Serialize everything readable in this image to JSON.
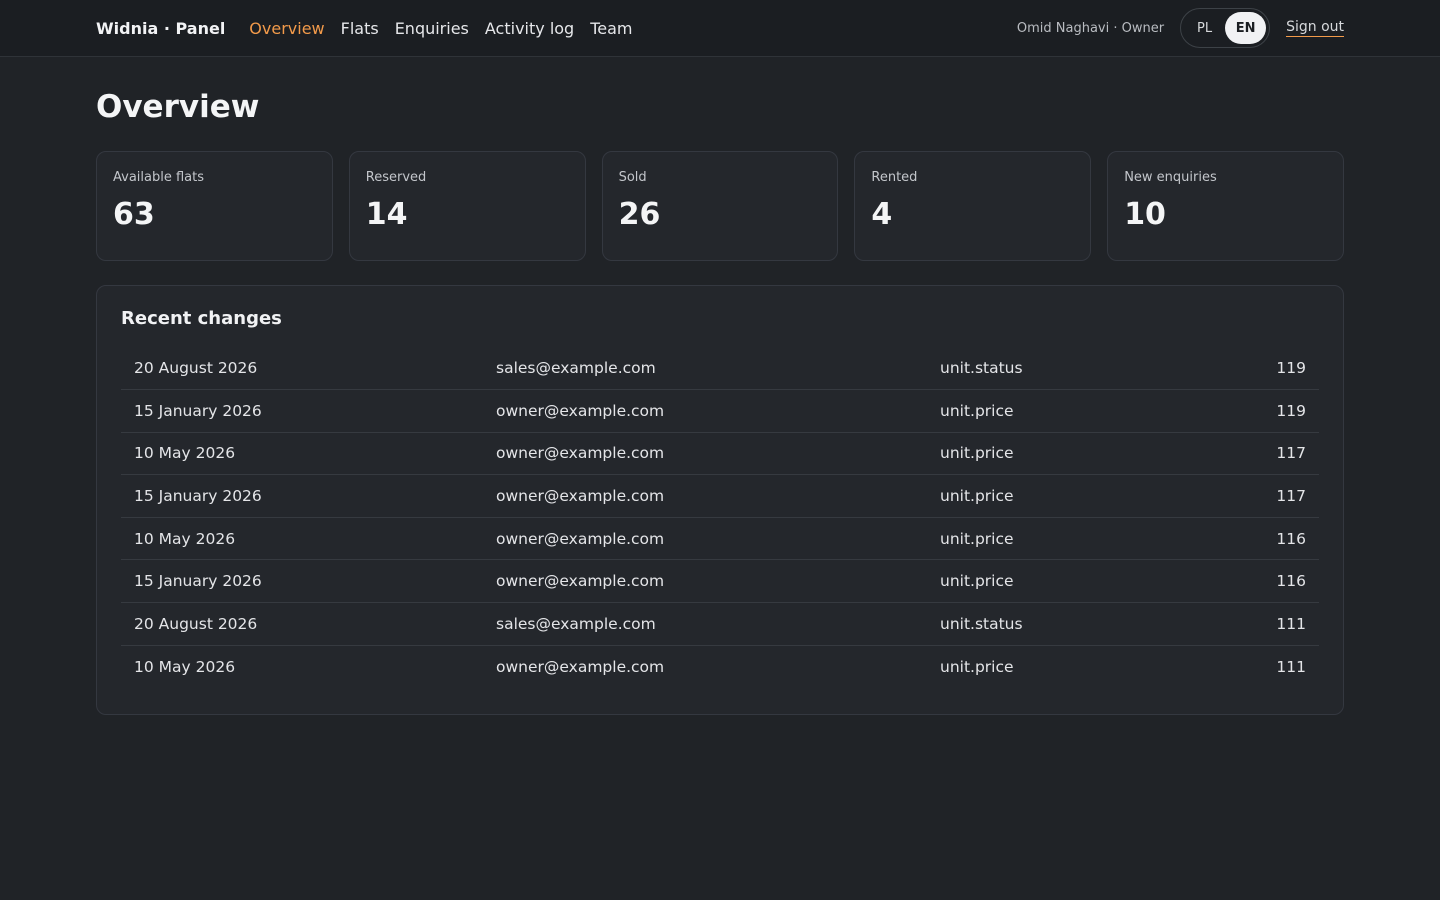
{
  "header": {
    "brand": "Widnia · Panel",
    "nav": [
      "Overview",
      "Flats",
      "Enquiries",
      "Activity log",
      "Team"
    ],
    "active_nav": "Overview",
    "user": "Omid Naghavi · Owner",
    "languages": [
      "PL",
      "EN"
    ],
    "active_language": "EN",
    "signout": "Sign out"
  },
  "page": {
    "title": "Overview"
  },
  "stats": [
    {
      "label": "Available flats",
      "value": "63"
    },
    {
      "label": "Reserved",
      "value": "14"
    },
    {
      "label": "Sold",
      "value": "26"
    },
    {
      "label": "Rented",
      "value": "4"
    },
    {
      "label": "New enquiries",
      "value": "10"
    }
  ],
  "recent": {
    "title": "Recent changes",
    "rows": [
      [
        "20 August 2026",
        "sales@example.com",
        "unit.status",
        "119"
      ],
      [
        "15 January 2026",
        "owner@example.com",
        "unit.price",
        "119"
      ],
      [
        "10 May 2026",
        "owner@example.com",
        "unit.price",
        "117"
      ],
      [
        "15 January 2026",
        "owner@example.com",
        "unit.price",
        "117"
      ],
      [
        "10 May 2026",
        "owner@example.com",
        "unit.price",
        "116"
      ],
      [
        "15 January 2026",
        "owner@example.com",
        "unit.price",
        "116"
      ],
      [
        "20 August 2026",
        "sales@example.com",
        "unit.status",
        "111"
      ],
      [
        "10 May 2026",
        "owner@example.com",
        "unit.price",
        "111"
      ]
    ]
  },
  "colors": {
    "accent": "#f29a4a",
    "background": "#202327",
    "card": "#24272c"
  }
}
